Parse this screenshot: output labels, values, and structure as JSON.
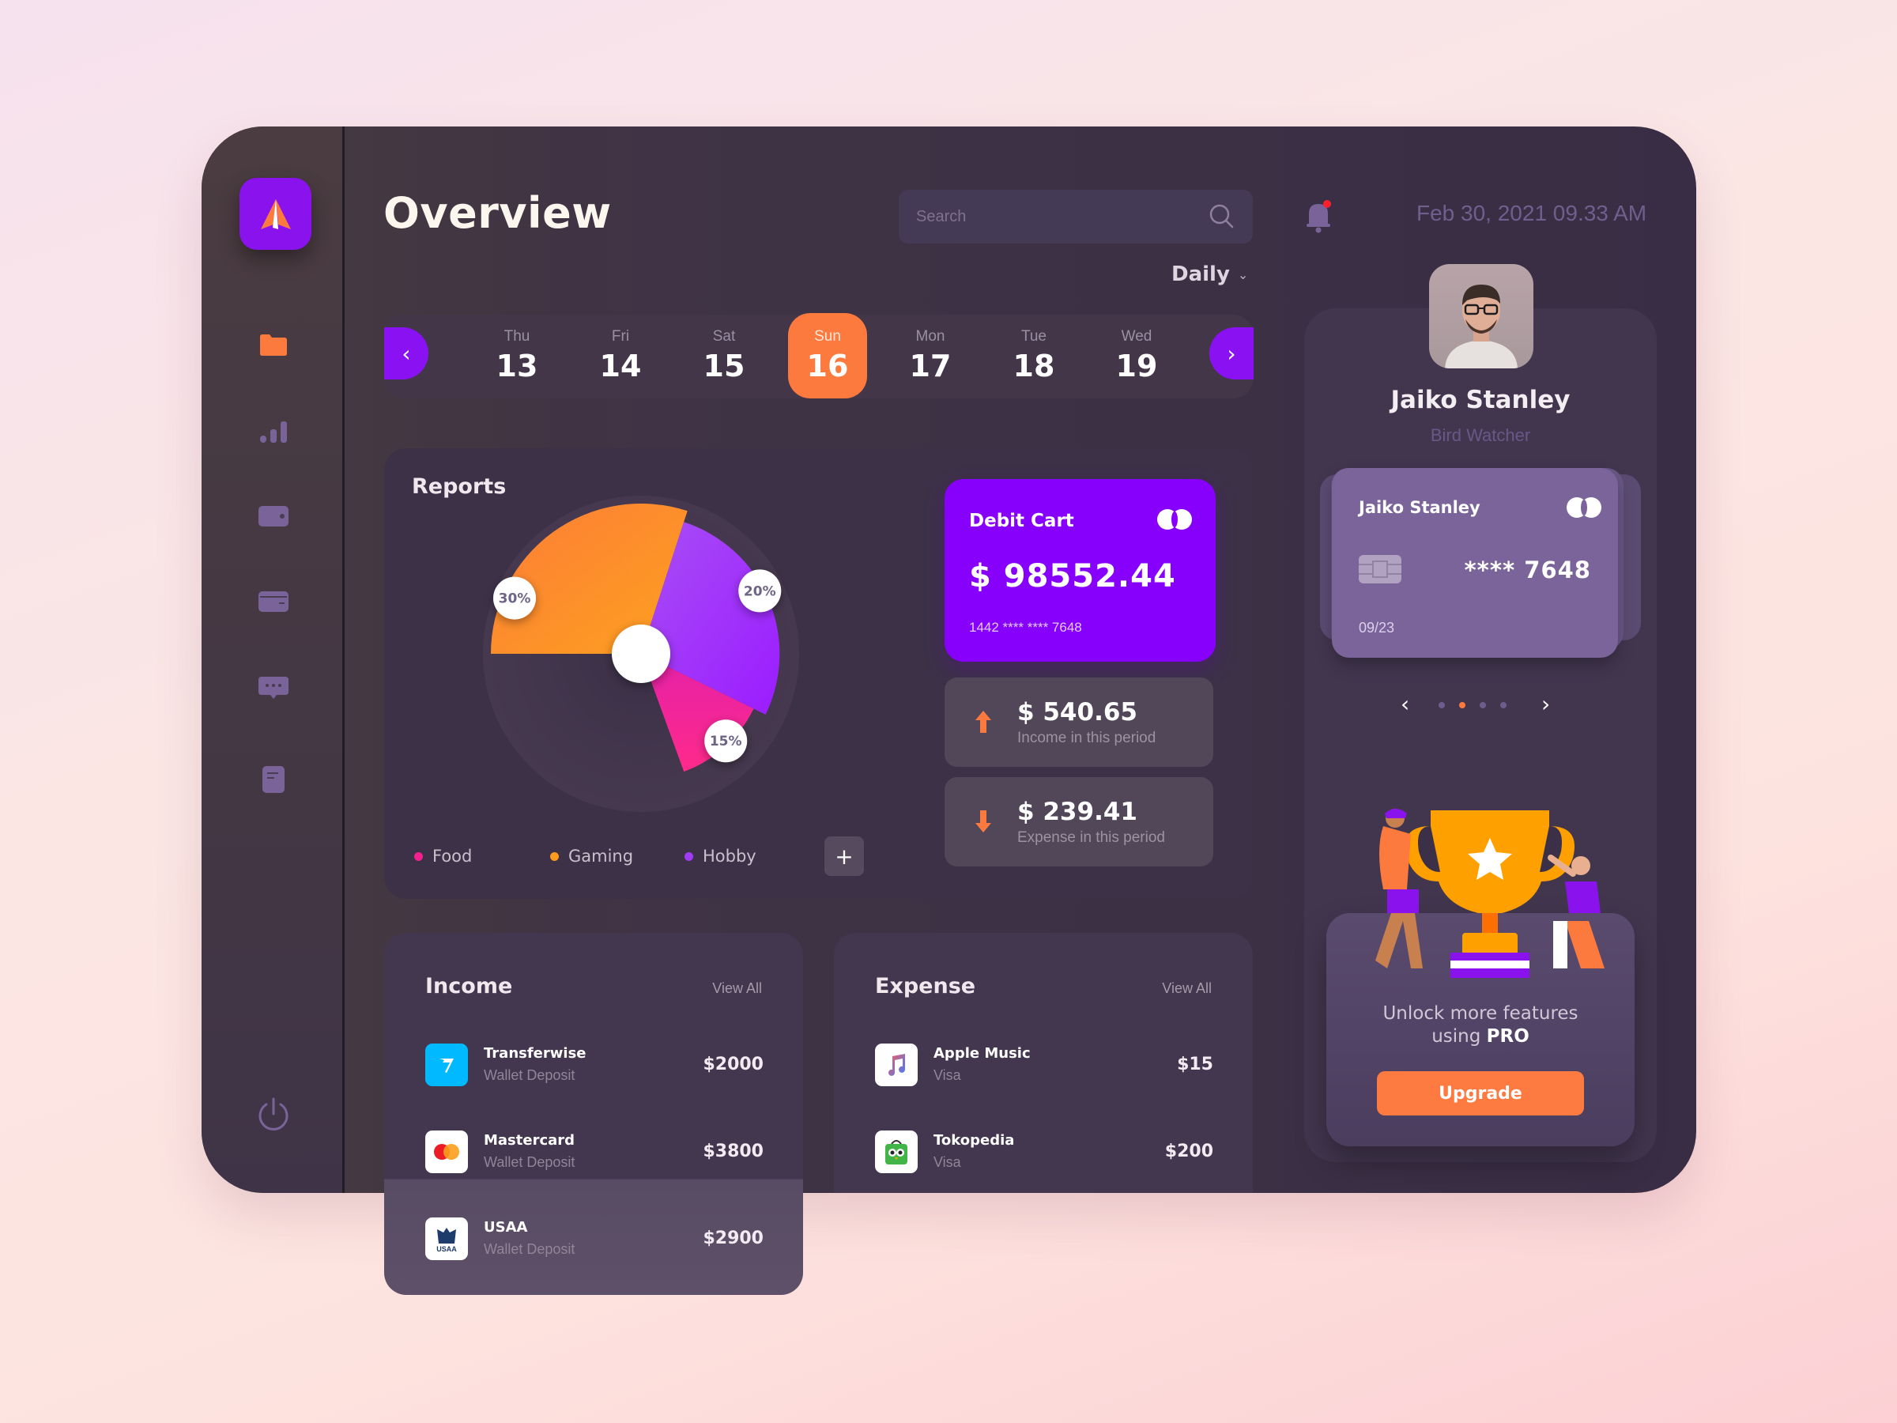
{
  "app": {
    "title": "Overview",
    "colors": {
      "accent_purple": "#8a12ec",
      "accent_orange": "#fd7a3e",
      "panel": "#3d3148"
    }
  },
  "sidebar": {
    "logo_icon": "paper-plane-logo",
    "items": [
      {
        "name": "folder",
        "icon": "folder-icon",
        "active": true
      },
      {
        "name": "stats",
        "icon": "bar-chart-icon",
        "active": false
      },
      {
        "name": "wallet",
        "icon": "wallet-icon",
        "active": false
      },
      {
        "name": "cards",
        "icon": "credit-card-icon",
        "active": false
      },
      {
        "name": "messages",
        "icon": "chat-bubble-icon",
        "active": false
      },
      {
        "name": "documents",
        "icon": "document-icon",
        "active": false
      }
    ],
    "power_icon": "power-icon"
  },
  "header": {
    "search_placeholder": "Search",
    "search_value": "",
    "notification_dot": true,
    "datetime": "Feb 30, 2021 09.33 AM",
    "period": "Daily",
    "period_chevron": "⌄"
  },
  "calendar": {
    "prev": "‹",
    "next": "›",
    "days": [
      {
        "dow": "Thu",
        "num": "13"
      },
      {
        "dow": "Fri",
        "num": "14"
      },
      {
        "dow": "Sat",
        "num": "15"
      },
      {
        "dow": "Sun",
        "num": "16",
        "active": true
      },
      {
        "dow": "Mon",
        "num": "17"
      },
      {
        "dow": "Tue",
        "num": "18"
      },
      {
        "dow": "Wed",
        "num": "19"
      }
    ]
  },
  "reports": {
    "title": "Reports",
    "add_label": "+",
    "legend": [
      {
        "label": "Food",
        "color": "#f3218f"
      },
      {
        "label": "Gaming",
        "color": "#fd9a1e"
      },
      {
        "label": "Hobby",
        "color": "#a23bf5"
      }
    ]
  },
  "chart_data": {
    "type": "pie",
    "variant": "polar-area",
    "title": "Reports",
    "slices": [
      {
        "label": "Gaming",
        "value": 30,
        "display": "30%",
        "color": "#fd8a2a"
      },
      {
        "label": "Hobby",
        "value": 20,
        "display": "20%",
        "color": "#a02ef5"
      },
      {
        "label": "Food",
        "value": 15,
        "display": "15%",
        "color": "#f8209a"
      }
    ],
    "legend_position": "bottom"
  },
  "debit_card": {
    "title": "Debit Cart",
    "balance": "$ 98552.44",
    "number": "1442 **** **** 7648",
    "brand_icon": "mastercard-icon"
  },
  "stats": {
    "income": {
      "value": "$ 540.65",
      "label": "Income in this period",
      "icon": "arrow-up-icon"
    },
    "expense": {
      "value": "$ 239.41",
      "label": "Expense in this period",
      "icon": "arrow-down-icon"
    }
  },
  "income": {
    "title": "Income",
    "view_all": "View All",
    "items": [
      {
        "name": "Transferwise",
        "sub": "Wallet Deposit",
        "amount": "$2000",
        "icon": "transferwise-icon"
      },
      {
        "name": "Mastercard",
        "sub": "Wallet Deposit",
        "amount": "$3800",
        "icon": "mastercard-icon"
      },
      {
        "name": "USAA",
        "sub": "Wallet Deposit",
        "amount": "$2900",
        "icon": "usaa-icon"
      }
    ]
  },
  "expense": {
    "title": "Expense",
    "view_all": "View All",
    "items": [
      {
        "name": "Apple Music",
        "sub": "Visa",
        "amount": "$15",
        "icon": "apple-music-icon"
      },
      {
        "name": "Tokopedia",
        "sub": "Visa",
        "amount": "$200",
        "icon": "tokopedia-icon"
      }
    ]
  },
  "profile": {
    "name": "Jaiko Stanley",
    "role": "Bird Watcher",
    "card": {
      "holder": "Jaiko Stanley",
      "digits": "**** 7648",
      "expiry": "09/23"
    },
    "carousel": {
      "prev": "‹",
      "next": "›",
      "count": 4,
      "active_index": 1
    }
  },
  "upgrade": {
    "text_line1": "Unlock more features",
    "text_line2_prefix": "using ",
    "text_line2_bold": "PRO",
    "button": "Upgrade"
  }
}
